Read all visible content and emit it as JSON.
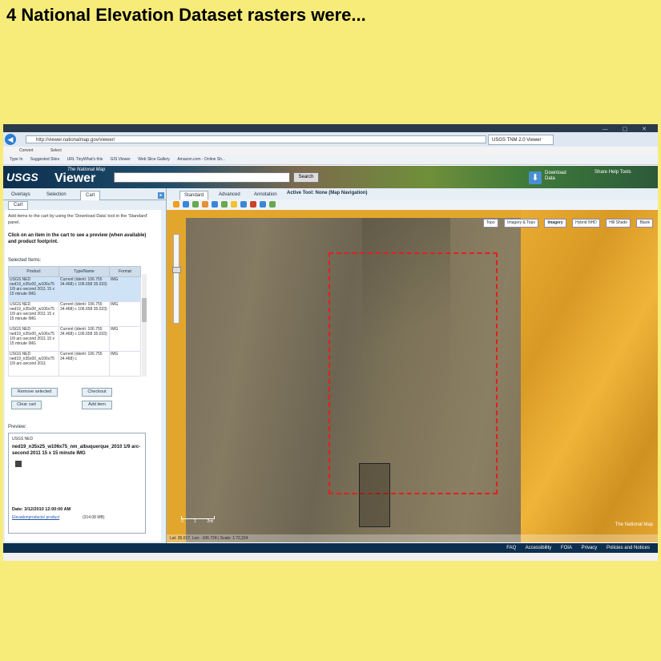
{
  "slide": {
    "title": "4 National Elevation Dataset rasters were..."
  },
  "browser": {
    "address": "http://viewer.nationalmap.gov/viewer/",
    "tab_title": "USGS TNM 2.0 Viewer",
    "menu": [
      "Convert",
      "Select"
    ],
    "favorites": [
      "Type In",
      "Suggested Sites",
      "URL TinyWhat's this",
      "GIS Viewer",
      "Web Slice Gallery",
      "Amazon.com - Online Sh..."
    ]
  },
  "header": {
    "logo": "USGS",
    "viewer_sub": "The National Map",
    "viewer_main": "Viewer",
    "search_button": "Search",
    "download_label": "Download Data",
    "links": [
      "Share",
      "Help",
      "Tools"
    ]
  },
  "left_panel": {
    "tabs": [
      "Overlays",
      "Selection",
      "Cart"
    ],
    "active_tab": "Cart",
    "subtab": "Cart",
    "instructions": "Add items to the cart by using the 'Download Data' tool in the 'Standard' panel.",
    "click_hint": "Click on an item in the cart to see a preview (when available) and product footprint.",
    "selected_label": "Selected Items:",
    "table_headers": [
      "Product",
      "Type/Name",
      "Format"
    ],
    "rows": [
      {
        "product": "USGS NED ned19_n35x00_w106x75 1/9 arc-second 2011 15 x 15 minute IMG",
        "type": "Current (identi: 106.755 34.468) c 106.658 35.033)",
        "format": "IMG"
      },
      {
        "product": "USGS NED ned19_n35x00_w106x75 1/9 arc-second 2011 15 x 15 minute IMG",
        "type": "Current (identi: 106.755 34.468) c 106.658 35.033)",
        "format": "IMG"
      },
      {
        "product": "USGS NED ned19_n35x00_w106x75 1/9 arc-second 2011 15 x 15 minute IMG",
        "type": "Current (identi: 106.755 34.468) c 106.658 35.033)",
        "format": "IMG"
      },
      {
        "product": "USGS NED ned19_n35x00_w106x75 1/9 arc-second 2011",
        "type": "Current (identi: 106.755 34.468) c",
        "format": "IMG"
      }
    ],
    "buttons": {
      "remove": "Remove selected",
      "checkout": "Checkout",
      "clear": "Clear cart",
      "add": "Add item"
    },
    "preview_label": "Preview:",
    "preview": {
      "title": "USGS NED",
      "name": "ned19_n35x25_w106x75_nm_albuquerque_2010 1/9 arc-second 2011 15 x 15 minute IMG",
      "date": "Date: 3/12/2010 12:00:00 AM",
      "link": "Elevationproducts/ product",
      "size": "(314.08 MB)"
    }
  },
  "map": {
    "tabs": [
      "Standard",
      "Advanced",
      "Annotation"
    ],
    "active_tool": "Active Tool: None (Map Navigation)",
    "basemaps": [
      "Topo",
      "Imagery & Topo",
      "Imagery",
      "Hybrid NHD",
      "Hill Shade",
      "Blank"
    ],
    "active_basemap": "Imagery",
    "scale": [
      "0",
      "1",
      "2mi"
    ],
    "credit": "The National Map",
    "coords": "Lat: 35.017, Lon: -106.724 | Scale: 1:72,224"
  },
  "footer": {
    "links": [
      "FAQ",
      "Accessibility",
      "FOIA",
      "Privacy",
      "Policies and Notices"
    ]
  }
}
